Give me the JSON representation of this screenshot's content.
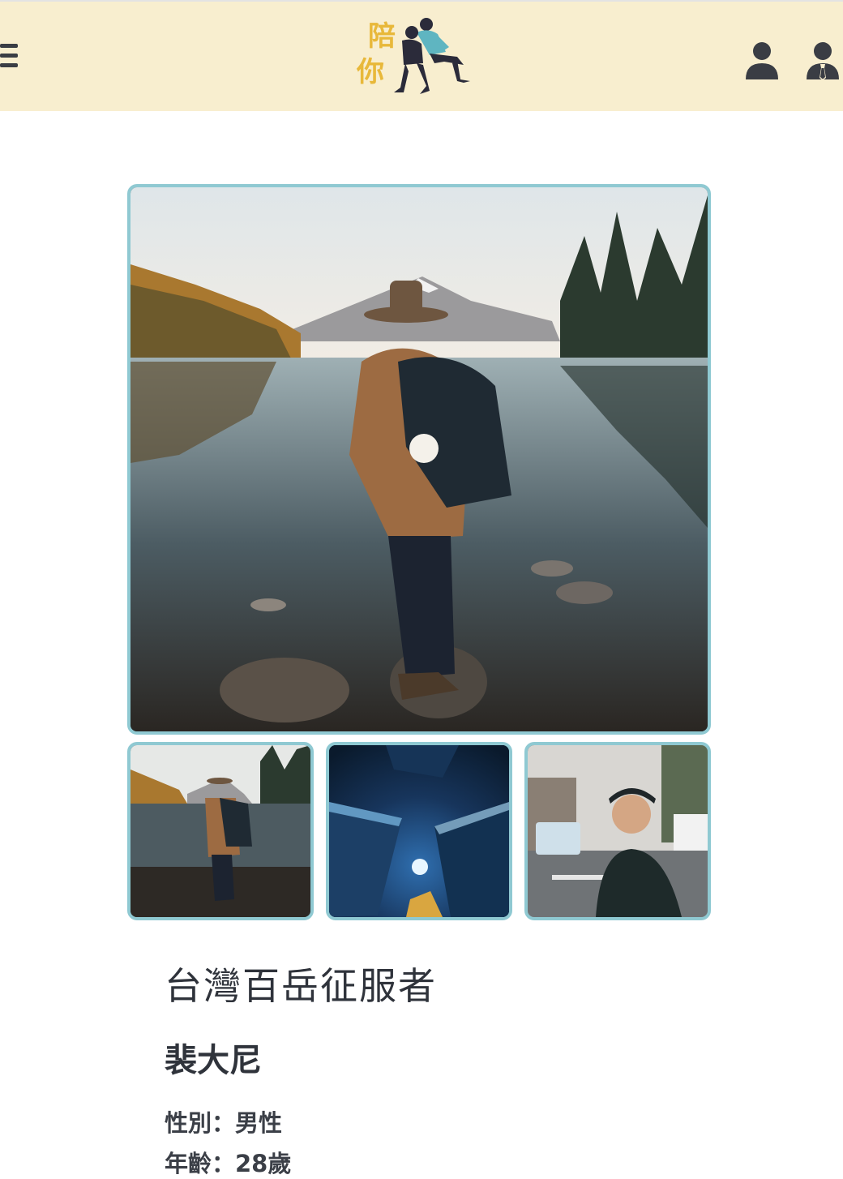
{
  "header": {
    "logo_text_top": "陪",
    "logo_text_bottom": "你",
    "icons": [
      "menu-icon",
      "user-icon",
      "admin-user-icon"
    ]
  },
  "gallery": {
    "main_photo": "hiker-at-lake-photo",
    "thumbnails": [
      "hiker-at-lake-photo",
      "city-skyscrapers-night-photo",
      "smiling-man-street-photo"
    ]
  },
  "profile": {
    "title": "台灣百岳征服者",
    "name": "裴大尼",
    "gender_label": "性別：男性",
    "age_label": "年齡：28歲"
  },
  "colors": {
    "header_bg": "#f8eecf",
    "photo_border": "#8fc9d2",
    "logo_yellow": "#e8b83a",
    "logo_teal": "#5fb5c1",
    "text_dark": "#2f333b"
  }
}
